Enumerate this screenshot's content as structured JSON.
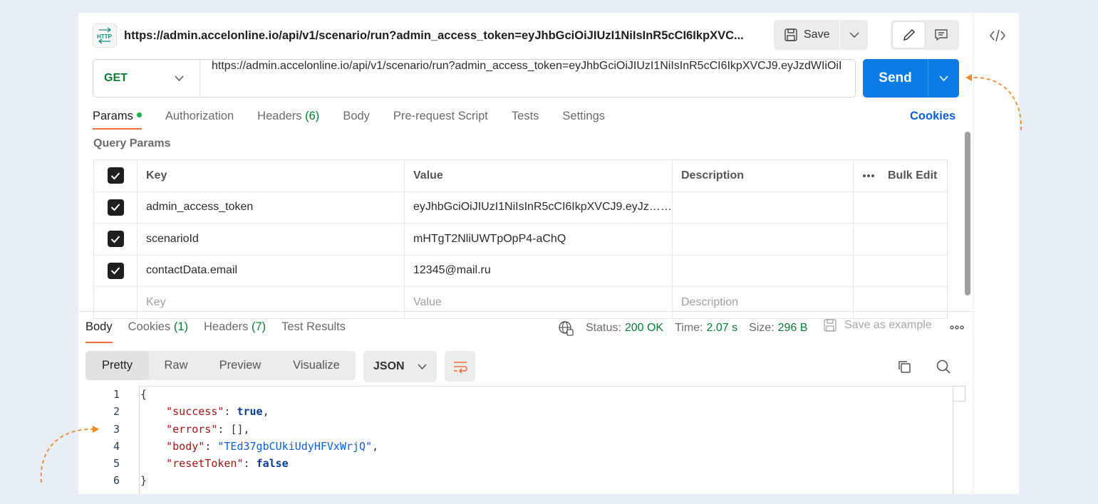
{
  "request": {
    "title": "https://admin.accelonline.io/api/v1/scenario/run?admin_access_token=eyJhbGciOiJIUzI1NiIsInR5cCI6IkpXVC...",
    "save_label": "Save",
    "method": "GET",
    "url": "https://admin.accelonline.io/api/v1/scenario/run?admin_access_token=eyJhbGciOiJIUzI1NiIsInR5cCI6IkpXVCJ9.eyJzdWIiOiI",
    "send_label": "Send",
    "cookies_label": "Cookies",
    "tabs": [
      {
        "label": "Params"
      },
      {
        "label": "Authorization"
      },
      {
        "label": "Headers",
        "count": "(6)"
      },
      {
        "label": "Body"
      },
      {
        "label": "Pre-request Script"
      },
      {
        "label": "Tests"
      },
      {
        "label": "Settings"
      }
    ],
    "section_label": "Query Params",
    "params": {
      "headers": {
        "key": "Key",
        "value": "Value",
        "description": "Description",
        "bulk_edit": "Bulk Edit"
      },
      "rows": [
        {
          "key": "admin_access_token",
          "value": "eyJhbGciOiJIUzI1NiIsInR5cCI6IkpXVCJ9.eyJzdWIiOiI",
          "description": ""
        },
        {
          "key": "scenarioId",
          "value": "mHTgT2NliUWTpOpP4-aChQ",
          "description": ""
        },
        {
          "key": "contactData.email",
          "value": "12345@mail.ru",
          "description": ""
        }
      ],
      "placeholders": {
        "key": "Key",
        "value": "Value",
        "description": "Description"
      }
    }
  },
  "response": {
    "tabs": [
      {
        "label": "Body"
      },
      {
        "label": "Cookies",
        "count": "(1)"
      },
      {
        "label": "Headers",
        "count": "(7)"
      },
      {
        "label": "Test Results"
      }
    ],
    "status_label": "Status:",
    "status_value": "200 OK",
    "time_label": "Time:",
    "time_value": "2.07 s",
    "size_label": "Size:",
    "size_value": "296 B",
    "save_example_label": "Save as example",
    "views": [
      "Pretty",
      "Raw",
      "Preview",
      "Visualize"
    ],
    "format": "JSON",
    "code_lines": [
      {
        "n": "1"
      },
      {
        "n": "2"
      },
      {
        "n": "3"
      },
      {
        "n": "4"
      },
      {
        "n": "5"
      },
      {
        "n": "6"
      }
    ],
    "json": {
      "open": "{",
      "k_success": "\"success\"",
      "v_success": "true",
      "k_errors": "\"errors\"",
      "v_errors": "[]",
      "k_body": "\"body\"",
      "v_body": "\"TEd37gbCUkiUdyHFVxWrjQ\"",
      "k_reset": "\"resetToken\"",
      "v_reset": "false",
      "close": "}"
    }
  },
  "colors": {
    "accent": "#f26b3a",
    "send": "#0b7be6",
    "method": "#0b7a33",
    "arrow": "#f0892b"
  }
}
